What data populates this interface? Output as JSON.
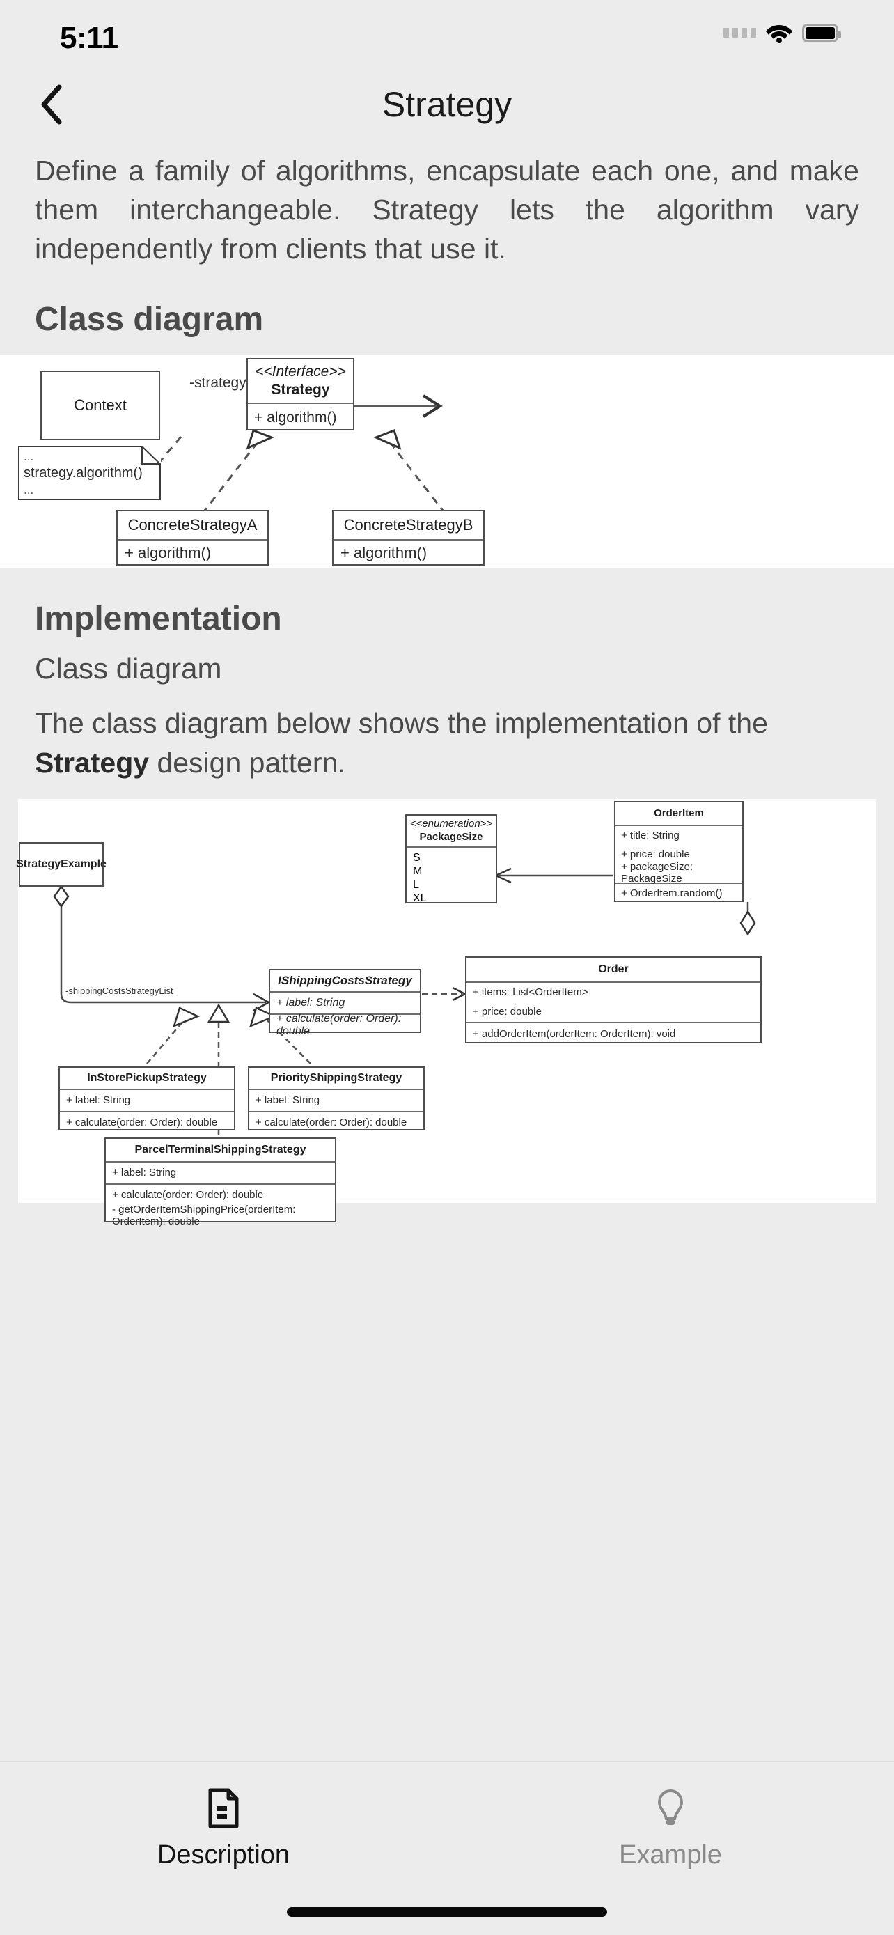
{
  "status_bar": {
    "time": "5:11",
    "icons": [
      "signal-dots-icon",
      "wifi-icon",
      "battery-icon"
    ]
  },
  "header": {
    "title": "Strategy",
    "back_icon": "chevron-left-icon"
  },
  "intro": {
    "text": "Define a family of algorithms, encapsulate each one, and make them interchangeable. Strategy lets the algorithm vary independently from clients that use it."
  },
  "sections": {
    "class_diagram_heading": "Class diagram",
    "implementation_heading": "Implementation",
    "implementation_sub_heading": "Class diagram",
    "implementation_text_before": "The class diagram below shows the implementation of the ",
    "implementation_text_bold": "Strategy",
    "implementation_text_after": " design pattern."
  },
  "diagram1": {
    "context": {
      "name": "Context"
    },
    "note": {
      "line1": "...",
      "line2": "strategy.algorithm()",
      "line3": "..."
    },
    "strategy": {
      "stereotype": "<<Interface>>",
      "name": "Strategy",
      "method": "+ algorithm()"
    },
    "association_label": "-strategy",
    "concrete_a": {
      "name": "ConcreteStrategyA",
      "method": "+ algorithm()"
    },
    "concrete_b": {
      "name": "ConcreteStrategyB",
      "method": "+ algorithm()"
    }
  },
  "diagram2": {
    "package_size": {
      "stereotype": "<<enumeration>>",
      "name": "PackageSize",
      "values": [
        "S",
        "M",
        "L",
        "XL"
      ]
    },
    "order_item": {
      "name": "OrderItem",
      "attributes": [
        "+ title: String",
        "+ price: double",
        "+ packageSize: PackageSize"
      ],
      "methods": [
        "+ OrderItem.random()"
      ]
    },
    "strategy_example": {
      "name": "StrategyExample"
    },
    "aggregation_label": "-shippingCostsStrategyList",
    "ishipping": {
      "name": "IShippingCostsStrategy",
      "attributes": [
        "+ label: String"
      ],
      "methods": [
        "+ calculate(order: Order): double"
      ]
    },
    "order": {
      "name": "Order",
      "attributes": [
        "+ items: List<OrderItem>",
        "+ price: double"
      ],
      "methods": [
        "+ addOrderItem(orderItem: OrderItem): void"
      ]
    },
    "in_store": {
      "name": "InStorePickupStrategy",
      "attributes": [
        "+ label: String"
      ],
      "methods": [
        "+ calculate(order: Order): double"
      ]
    },
    "priority": {
      "name": "PriorityShippingStrategy",
      "attributes": [
        "+ label: String"
      ],
      "methods": [
        "+ calculate(order: Order): double"
      ]
    },
    "parcel": {
      "name": "ParcelTerminalShippingStrategy",
      "attributes": [
        "+ label: String"
      ],
      "methods": [
        "+ calculate(order: Order): double",
        "- getOrderItemShippingPrice(orderItem: OrderItem): double"
      ]
    }
  },
  "tab_bar": {
    "tabs": [
      {
        "label": "Description",
        "icon": "document-icon",
        "active": true
      },
      {
        "label": "Example",
        "icon": "lightbulb-icon",
        "active": false
      }
    ]
  },
  "colors": {
    "background": "#ececec",
    "card": "#ffffff",
    "text": "#4a4a4a",
    "active": "#141414",
    "inactive": "#8a8a8a",
    "stroke": "#4e4e4e"
  }
}
